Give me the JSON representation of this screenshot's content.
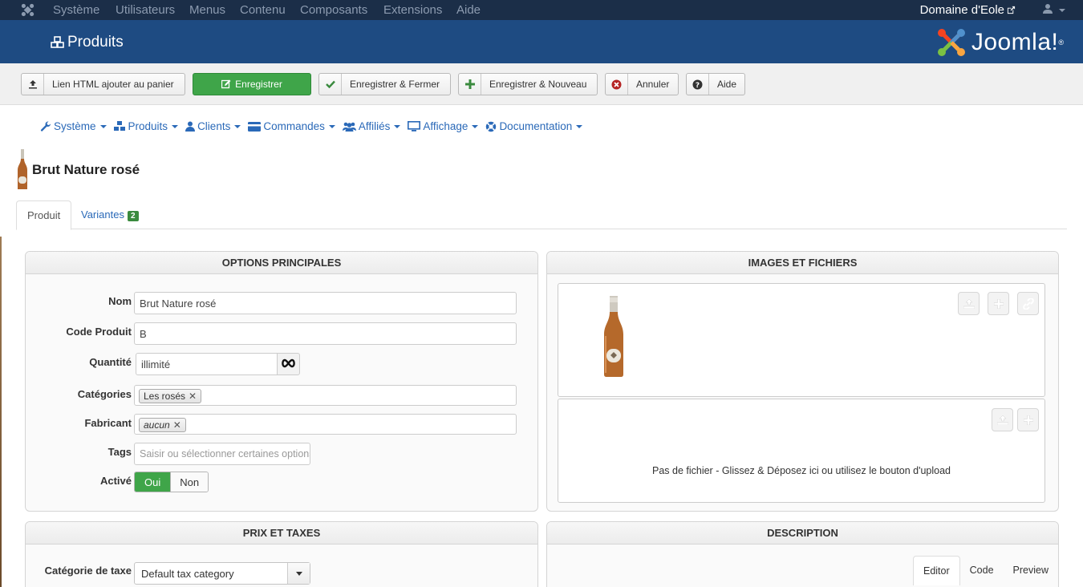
{
  "topbar": {
    "menu": [
      "Système",
      "Utilisateurs",
      "Menus",
      "Contenu",
      "Composants",
      "Extensions",
      "Aide"
    ],
    "site_name": "Domaine d'Eole"
  },
  "header": {
    "page_title": "Produits",
    "brand": "Joomla!"
  },
  "toolbar": {
    "html_cart_label": "Lien HTML ajouter au panier",
    "save_label": "Enregistrer",
    "save_close_label": "Enregistrer & Fermer",
    "save_new_label": "Enregistrer & Nouveau",
    "cancel_label": "Annuler",
    "help_label": "Aide"
  },
  "submenu": [
    "Système",
    "Produits",
    "Clients",
    "Commandes",
    "Affiliés",
    "Affichage",
    "Documentation"
  ],
  "product": {
    "title": "Brut Nature rosé"
  },
  "tabs": {
    "product": "Produit",
    "variants": "Variantes",
    "variants_count": "2"
  },
  "main_options": {
    "heading": "OPTIONS PRINCIPALES",
    "name_label": "Nom",
    "name_value": "Brut Nature rosé",
    "code_label": "Code Produit",
    "code_value": "B",
    "quantity_label": "Quantité",
    "quantity_value": "illimité",
    "categories_label": "Catégories",
    "category_chip": "Les rosés",
    "manufacturer_label": "Fabricant",
    "manufacturer_chip": "aucun",
    "tags_label": "Tags",
    "tags_placeholder": "Saisir ou sélectionner certaines options",
    "active_label": "Activé",
    "active_yes": "Oui",
    "active_no": "Non"
  },
  "images_files": {
    "heading": "IMAGES ET FICHIERS",
    "no_file_text": "Pas de fichier - Glissez & Déposez ici ou utilisez le bouton d'upload"
  },
  "prices": {
    "heading": "PRIX ET TAXES",
    "tax_category_label": "Catégorie de taxe",
    "tax_category_value": "Default tax category"
  },
  "description": {
    "heading": "DESCRIPTION",
    "tabs": [
      "Editor",
      "Code",
      "Preview"
    ]
  },
  "colors": {
    "topbar": "#1b2e48",
    "header": "#1e4b82",
    "accent_green": "#3fa549",
    "link_blue": "#2a69b8"
  }
}
